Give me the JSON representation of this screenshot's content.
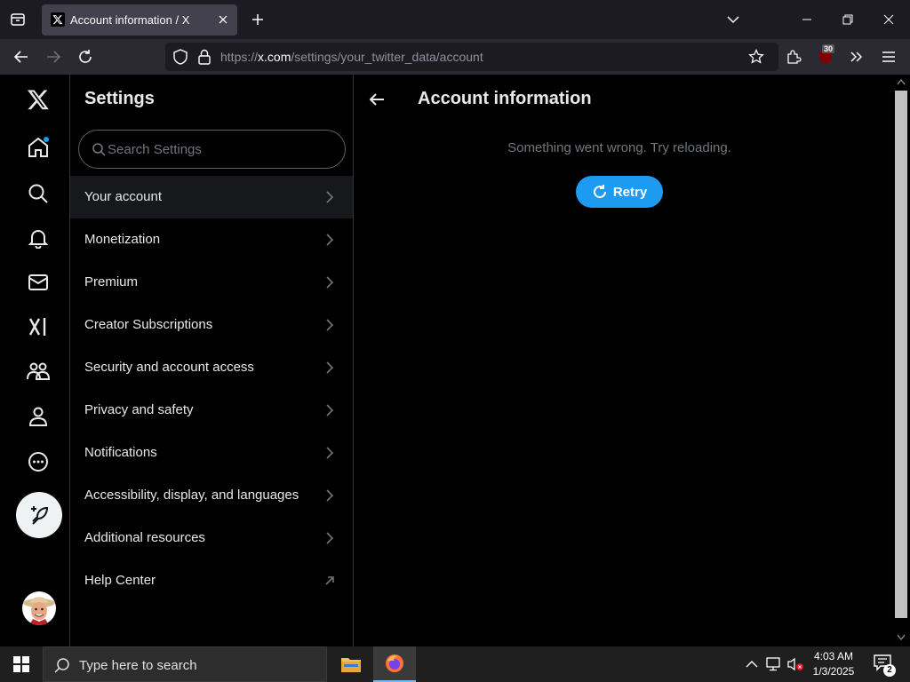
{
  "browser": {
    "tab_title": "Account information / X",
    "url_prefix": "https://",
    "url_host": "x.com",
    "url_path": "/settings/your_twitter_data/account",
    "extension_badge": "30"
  },
  "settings": {
    "title": "Settings",
    "search_placeholder": "Search Settings",
    "items": [
      {
        "label": "Your account",
        "icon": "chevron-right-icon"
      },
      {
        "label": "Monetization",
        "icon": "chevron-right-icon"
      },
      {
        "label": "Premium",
        "icon": "chevron-right-icon"
      },
      {
        "label": "Creator Subscriptions",
        "icon": "chevron-right-icon"
      },
      {
        "label": "Security and account access",
        "icon": "chevron-right-icon"
      },
      {
        "label": "Privacy and safety",
        "icon": "chevron-right-icon"
      },
      {
        "label": "Notifications",
        "icon": "chevron-right-icon"
      },
      {
        "label": "Accessibility, display, and languages",
        "icon": "chevron-right-icon"
      },
      {
        "label": "Additional resources",
        "icon": "chevron-right-icon"
      },
      {
        "label": "Help Center",
        "icon": "external-link-icon"
      }
    ]
  },
  "main": {
    "title": "Account information",
    "error_message": "Something went wrong. Try reloading.",
    "retry_label": "Retry"
  },
  "taskbar": {
    "search_placeholder": "Type here to search",
    "time": "4:03 AM",
    "date": "1/3/2025",
    "notification_count": "2"
  },
  "colors": {
    "accent": "#1d9bf0",
    "background": "#000000",
    "text_primary": "#e7e9ea",
    "text_secondary": "#71767b"
  }
}
